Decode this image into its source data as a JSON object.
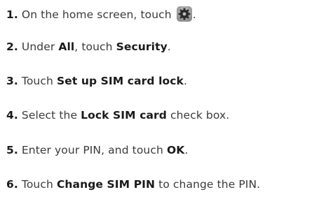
{
  "steps": [
    {
      "number": "1.",
      "before": "On the home screen, touch",
      "icon": "settings-gear-icon",
      "after": "."
    },
    {
      "number": "2.",
      "t1": "Under",
      "b1": "All",
      "t2": ", touch",
      "b2": "Security",
      "t3": "."
    },
    {
      "number": "3.",
      "t1": "Touch",
      "b1": "Set up SIM card lock",
      "t2": "."
    },
    {
      "number": "4.",
      "t1": "Select the",
      "b1": "Lock SIM card",
      "t2": "check box."
    },
    {
      "number": "5.",
      "t1": "Enter your PIN, and touch",
      "b1": "OK",
      "t2": "."
    },
    {
      "number": "6.",
      "t1": "Touch",
      "b1": "Change SIM PIN",
      "t2": "to change the PIN."
    }
  ]
}
